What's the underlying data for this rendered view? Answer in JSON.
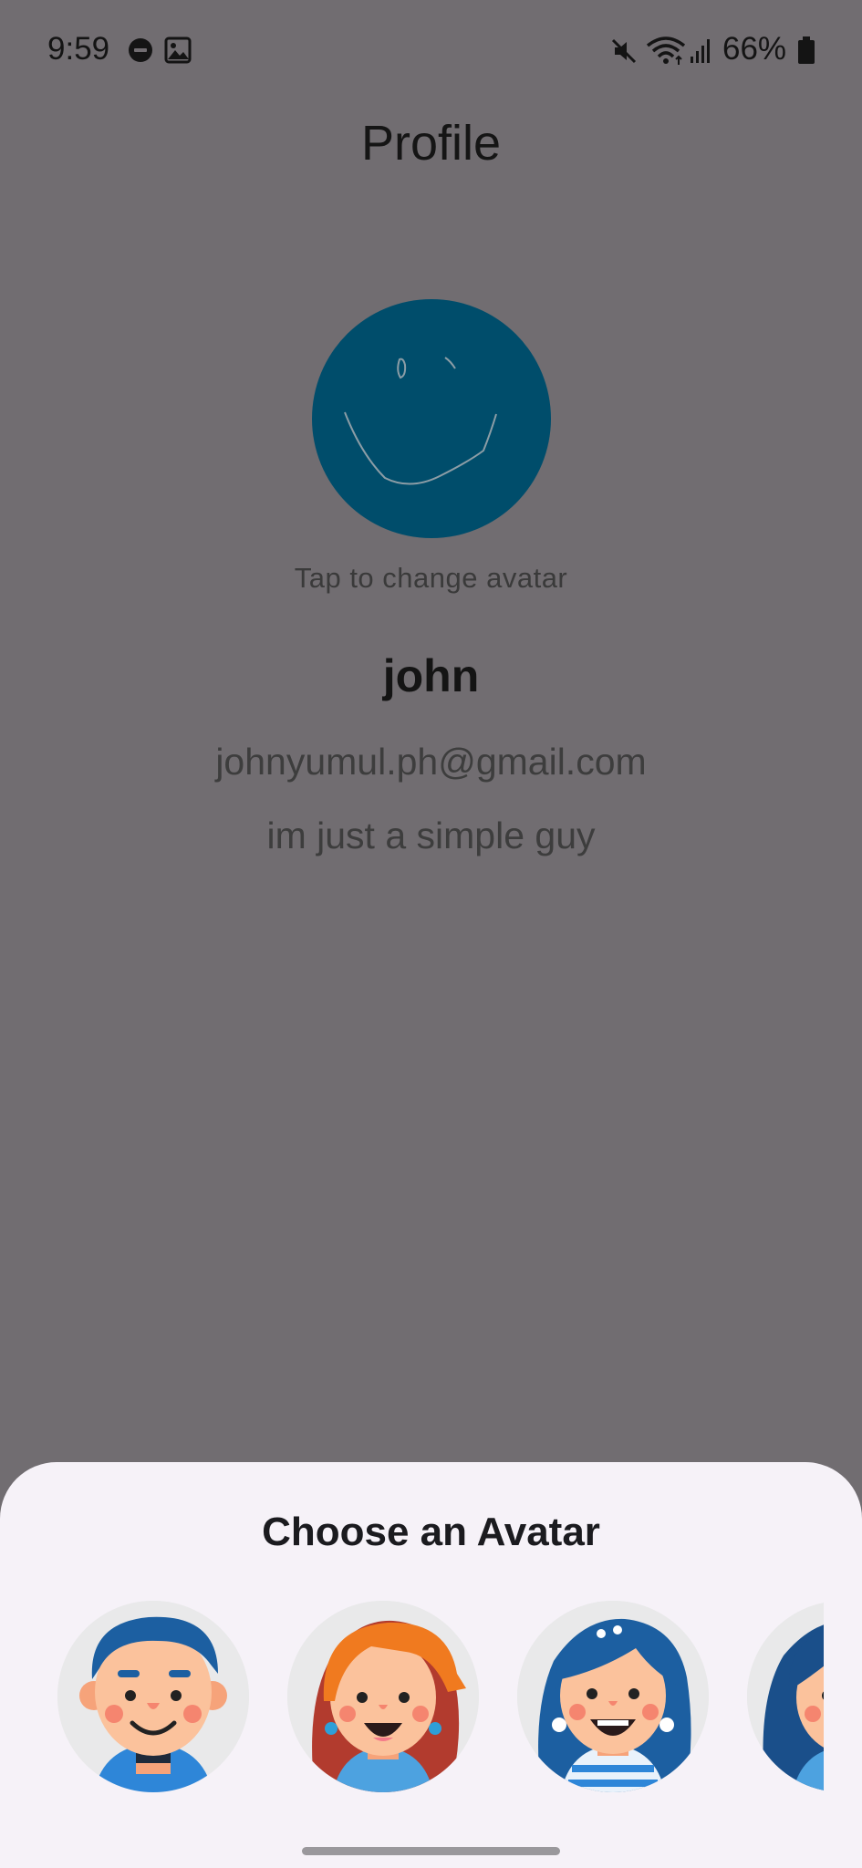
{
  "status_bar": {
    "time": "9:59",
    "battery_percent": "66%",
    "icons": [
      "do-not-disturb-icon",
      "gallery-icon",
      "mute-icon",
      "wifi-icon",
      "signal-icon",
      "battery-icon"
    ]
  },
  "header": {
    "title": "Profile"
  },
  "profile": {
    "avatar_hint": "Tap to change avatar",
    "name": "john",
    "email": "johnyumul.ph@gmail.com",
    "bio": "im just a simple guy",
    "avatar_color": "#004d6b"
  },
  "avatar_sheet": {
    "title": "Choose an Avatar"
  },
  "colors": {
    "backdrop": "#716d71",
    "sheet_background": "#f6f2f8",
    "avatar_circle": "#004d6b"
  }
}
